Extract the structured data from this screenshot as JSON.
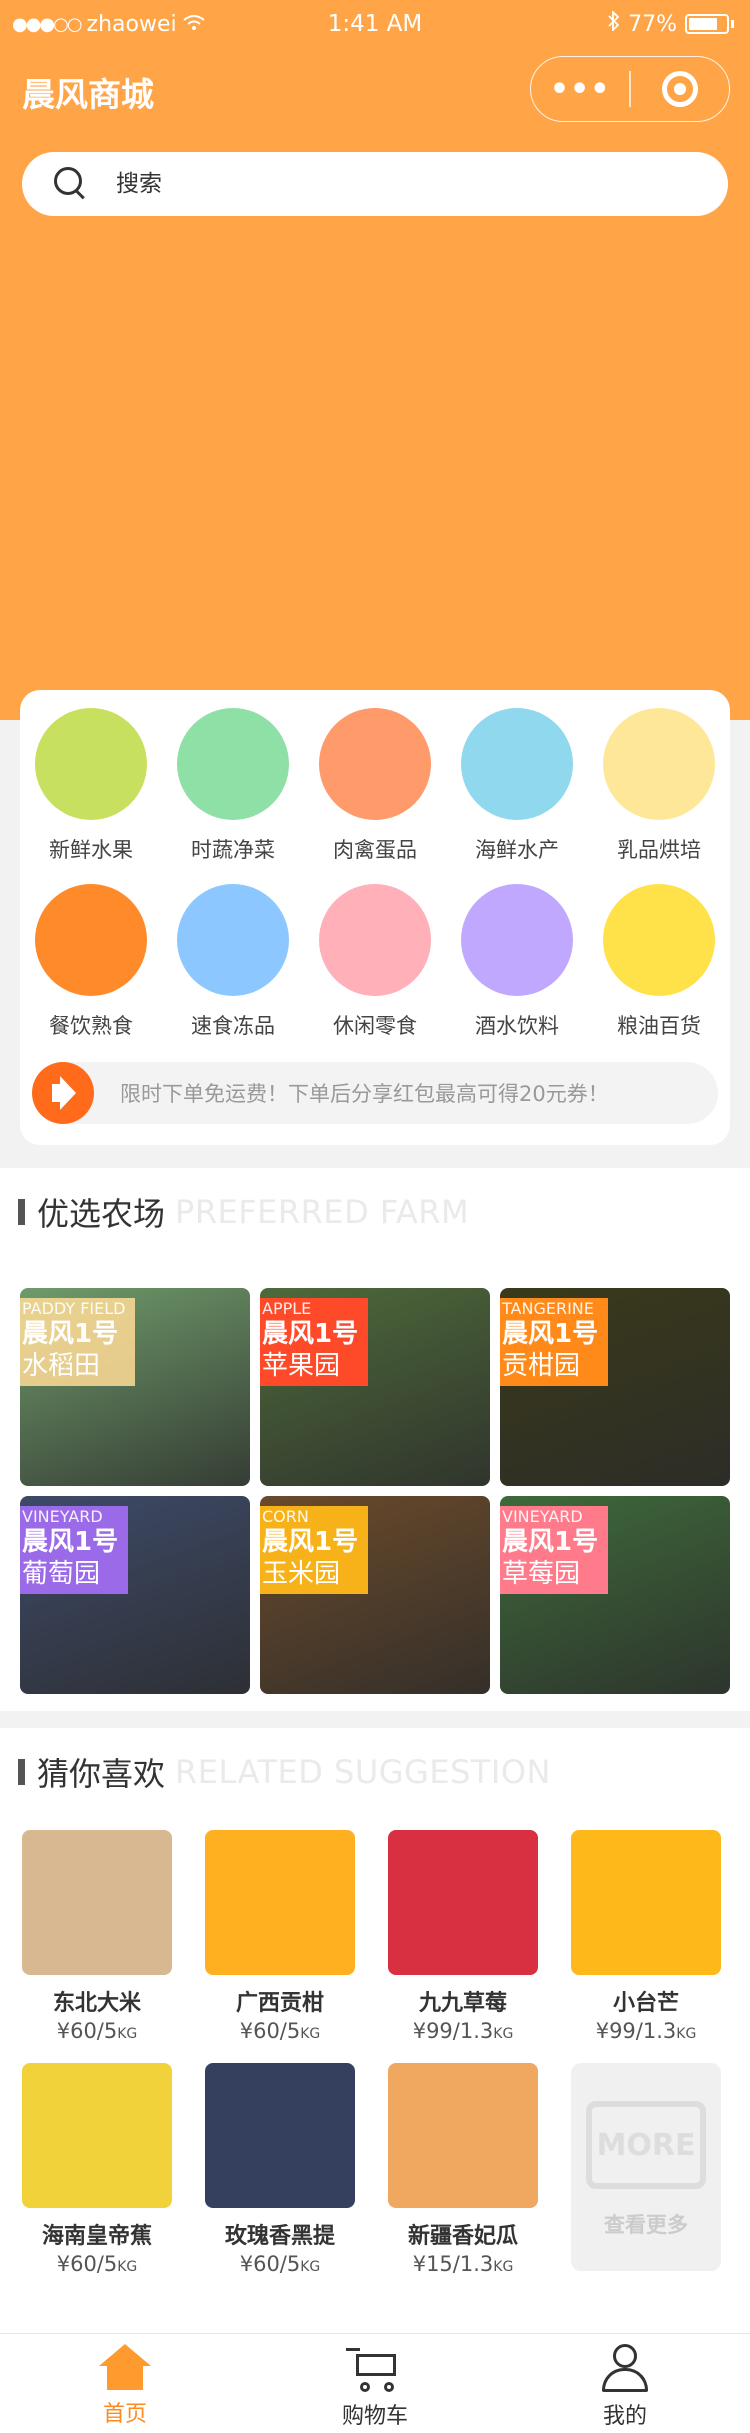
{
  "status_bar": {
    "carrier": "zhaowei",
    "time": "1:41 AM",
    "battery": "77%"
  },
  "navbar": {
    "title": "晨风商城"
  },
  "search": {
    "placeholder": "搜索"
  },
  "categories": [
    {
      "label": "新鲜水果",
      "color": "#c8e060"
    },
    {
      "label": "时蔬净菜",
      "color": "#8fe0a6"
    },
    {
      "label": "肉禽蛋品",
      "color": "#ff9a6a"
    },
    {
      "label": "海鲜水产",
      "color": "#8fd8ee"
    },
    {
      "label": "乳品烘培",
      "color": "#ffe79a"
    },
    {
      "label": "餐饮熟食",
      "color": "#ff8a2a"
    },
    {
      "label": "速食冻品",
      "color": "#8cc8ff"
    },
    {
      "label": "休闲零食",
      "color": "#ffb0b8"
    },
    {
      "label": "酒水饮料",
      "color": "#c0a8ff"
    },
    {
      "label": "粮油百货",
      "color": "#ffe24a"
    }
  ],
  "notice": {
    "text": "限时下单免运费！下单后分享红包最高可得20元券！"
  },
  "farm_section": {
    "title": "优选农场",
    "subtitle": "PREFERRED FARM",
    "farms": [
      {
        "en": "PADDY FIELD",
        "brand": "晨风1号",
        "name": "水稻田",
        "label_color": "rgba(255,220,150,0.85)",
        "bg": "#6f9b6a"
      },
      {
        "en": "APPLE",
        "brand": "晨风1号",
        "name": "苹果园",
        "label_color": "#ff4a2a",
        "bg": "#4e6a3a"
      },
      {
        "en": "TANGERINE",
        "brand": "晨风1号",
        "name": "贡柑园",
        "label_color": "#ff8a1a",
        "bg": "#3a3a1a"
      },
      {
        "en": "VINEYARD",
        "brand": "晨风1号",
        "name": "葡萄园",
        "label_color": "#9a6ae8",
        "bg": "#3d4a68"
      },
      {
        "en": "CORN",
        "brand": "晨风1号",
        "name": "玉米园",
        "label_color": "#f7b21a",
        "bg": "#6a4a2a"
      },
      {
        "en": "VINEYARD",
        "brand": "晨风1号",
        "name": "草莓园",
        "label_color": "#ff7a8a",
        "bg": "#3e6a3a"
      }
    ]
  },
  "suggest_section": {
    "title": "猜你喜欢",
    "subtitle": "RELATED SUGGESTION",
    "products": [
      {
        "name": "东北大米",
        "price": "¥60/5",
        "unit": "KG",
        "bg": "#d8b890"
      },
      {
        "name": "广西贡柑",
        "price": "¥60/5",
        "unit": "KG",
        "bg": "#ffb020"
      },
      {
        "name": "九九草莓",
        "price": "¥99/1.3",
        "unit": "KG",
        "bg": "#d83040"
      },
      {
        "name": "小台芒",
        "price": "¥99/1.3",
        "unit": "KG",
        "bg": "#ffb81a"
      },
      {
        "name": "海南皇帝蕉",
        "price": "¥60/5",
        "unit": "KG",
        "bg": "#f2d23a"
      },
      {
        "name": "玫瑰香黑提",
        "price": "¥60/5",
        "unit": "KG",
        "bg": "#34405e"
      },
      {
        "name": "新疆香妃瓜",
        "price": "¥15/1.3",
        "unit": "KG",
        "bg": "#f0a860"
      }
    ],
    "more": {
      "icon_text": "MORE",
      "label": "查看更多"
    }
  },
  "tabbar": {
    "home": "首页",
    "cart": "购物车",
    "me": "我的"
  }
}
